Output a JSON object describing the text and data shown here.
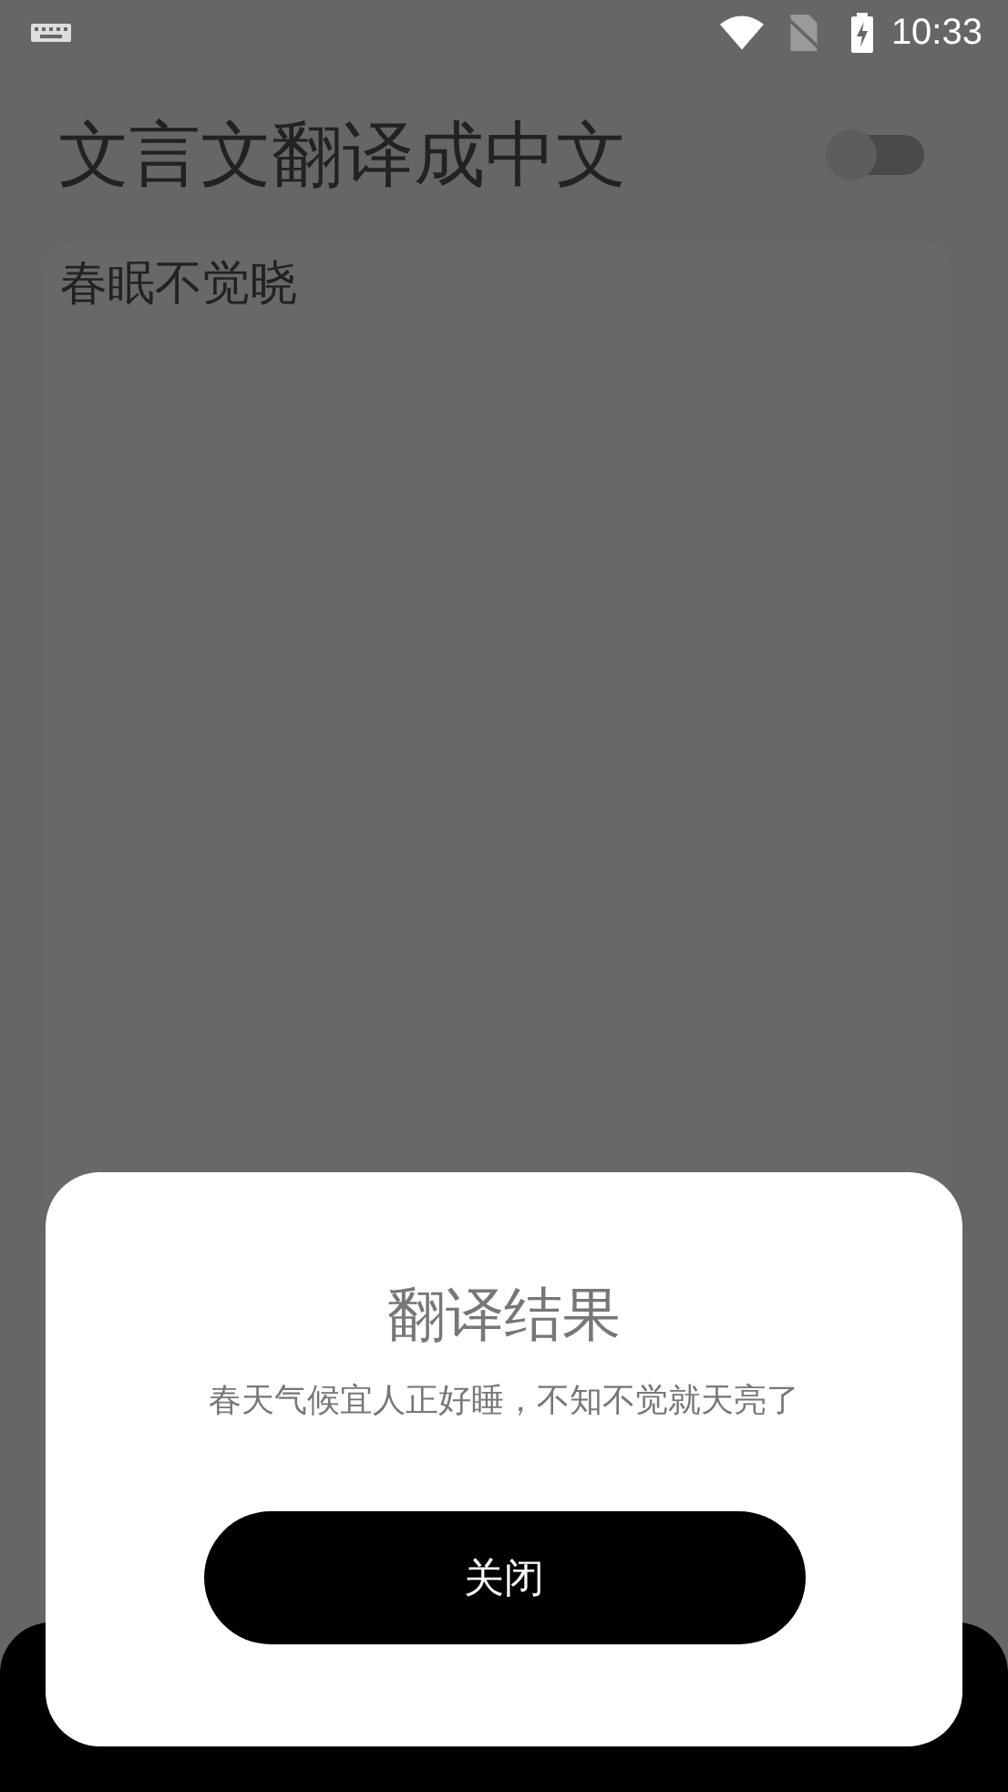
{
  "status_bar": {
    "time": "10:33"
  },
  "header": {
    "title": "文言文翻译成中文",
    "toggle": {
      "on": false
    }
  },
  "input": {
    "value": "春眠不觉晓"
  },
  "dialog": {
    "title": "翻译结果",
    "message": "春天气候宜人正好睡，不知不觉就天亮了",
    "button": "关闭"
  }
}
